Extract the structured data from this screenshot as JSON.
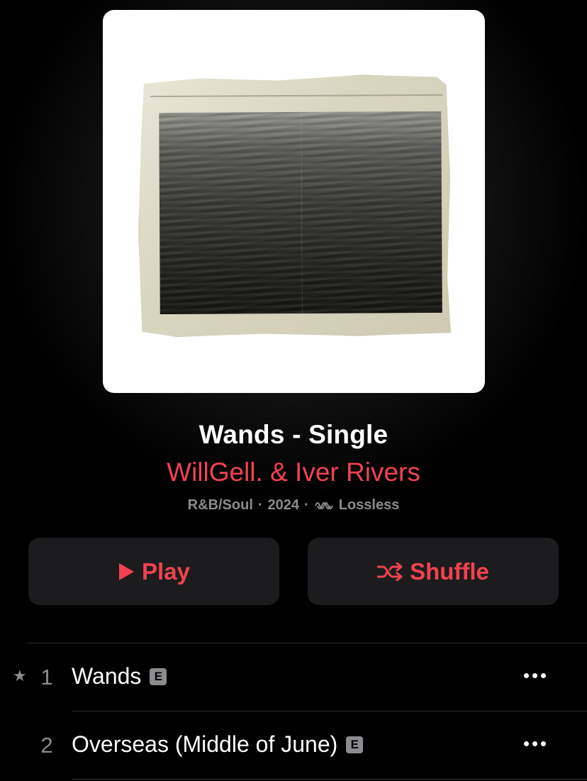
{
  "album": {
    "title": "Wands - Single",
    "artist": "WillGell. & Iver Rivers",
    "genre": "R&B/Soul",
    "year": "2024",
    "separator": "·",
    "quality": "Lossless",
    "quality_icon": "lossless-waveform-icon"
  },
  "actions": {
    "play_label": "Play",
    "play_icon": "play-icon",
    "shuffle_label": "Shuffle",
    "shuffle_icon": "shuffle-icon"
  },
  "colors": {
    "accent": "#f2424f",
    "background": "#000000",
    "button_bg": "#1c1c1e",
    "secondary_text": "#8c8c90"
  },
  "tracks": [
    {
      "number": "1",
      "title": "Wands",
      "explicit": "E",
      "popular_marker": "★"
    },
    {
      "number": "2",
      "title": "Overseas (Middle of June)",
      "explicit": "E",
      "popular_marker": ""
    }
  ]
}
